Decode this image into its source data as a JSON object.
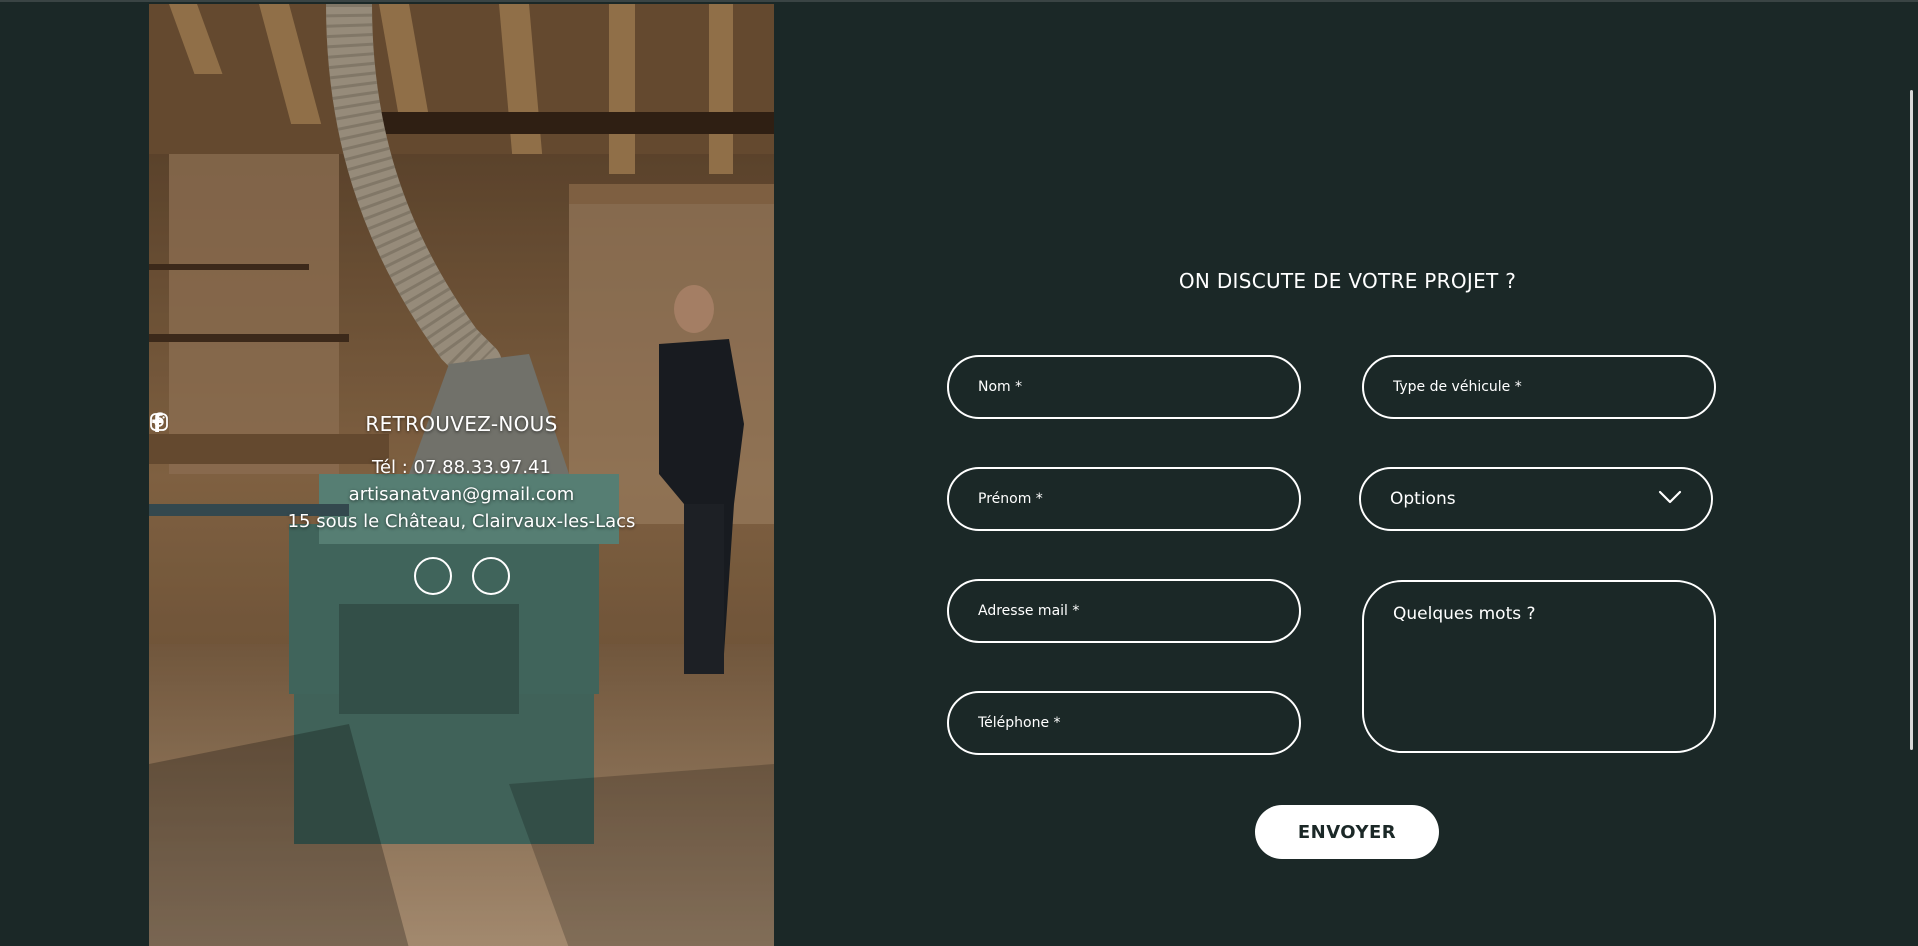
{
  "contact": {
    "title": "RETROUVEZ-NOUS",
    "phone": "Tél : 07.88.33.97.41",
    "email": "artisanatvan@gmail.com",
    "address": "15 sous le Château, Clairvaux-les-Lacs",
    "social": [
      {
        "icon": "facebook-icon"
      },
      {
        "icon": "instagram-icon"
      }
    ]
  },
  "form": {
    "title": "ON DISCUTE DE VOTRE PROJET ?",
    "nom_placeholder": "Nom *",
    "prenom_placeholder": "Prénom *",
    "mail_placeholder": "Adresse mail *",
    "tel_placeholder": "Téléphone *",
    "type_placeholder": "Type de véhicule *",
    "options_label": "Options",
    "mots_placeholder": "Quelques mots ?",
    "submit_label": "ENVOYER"
  },
  "colors": {
    "background": "#1b2827",
    "accent": "#ffffff"
  }
}
